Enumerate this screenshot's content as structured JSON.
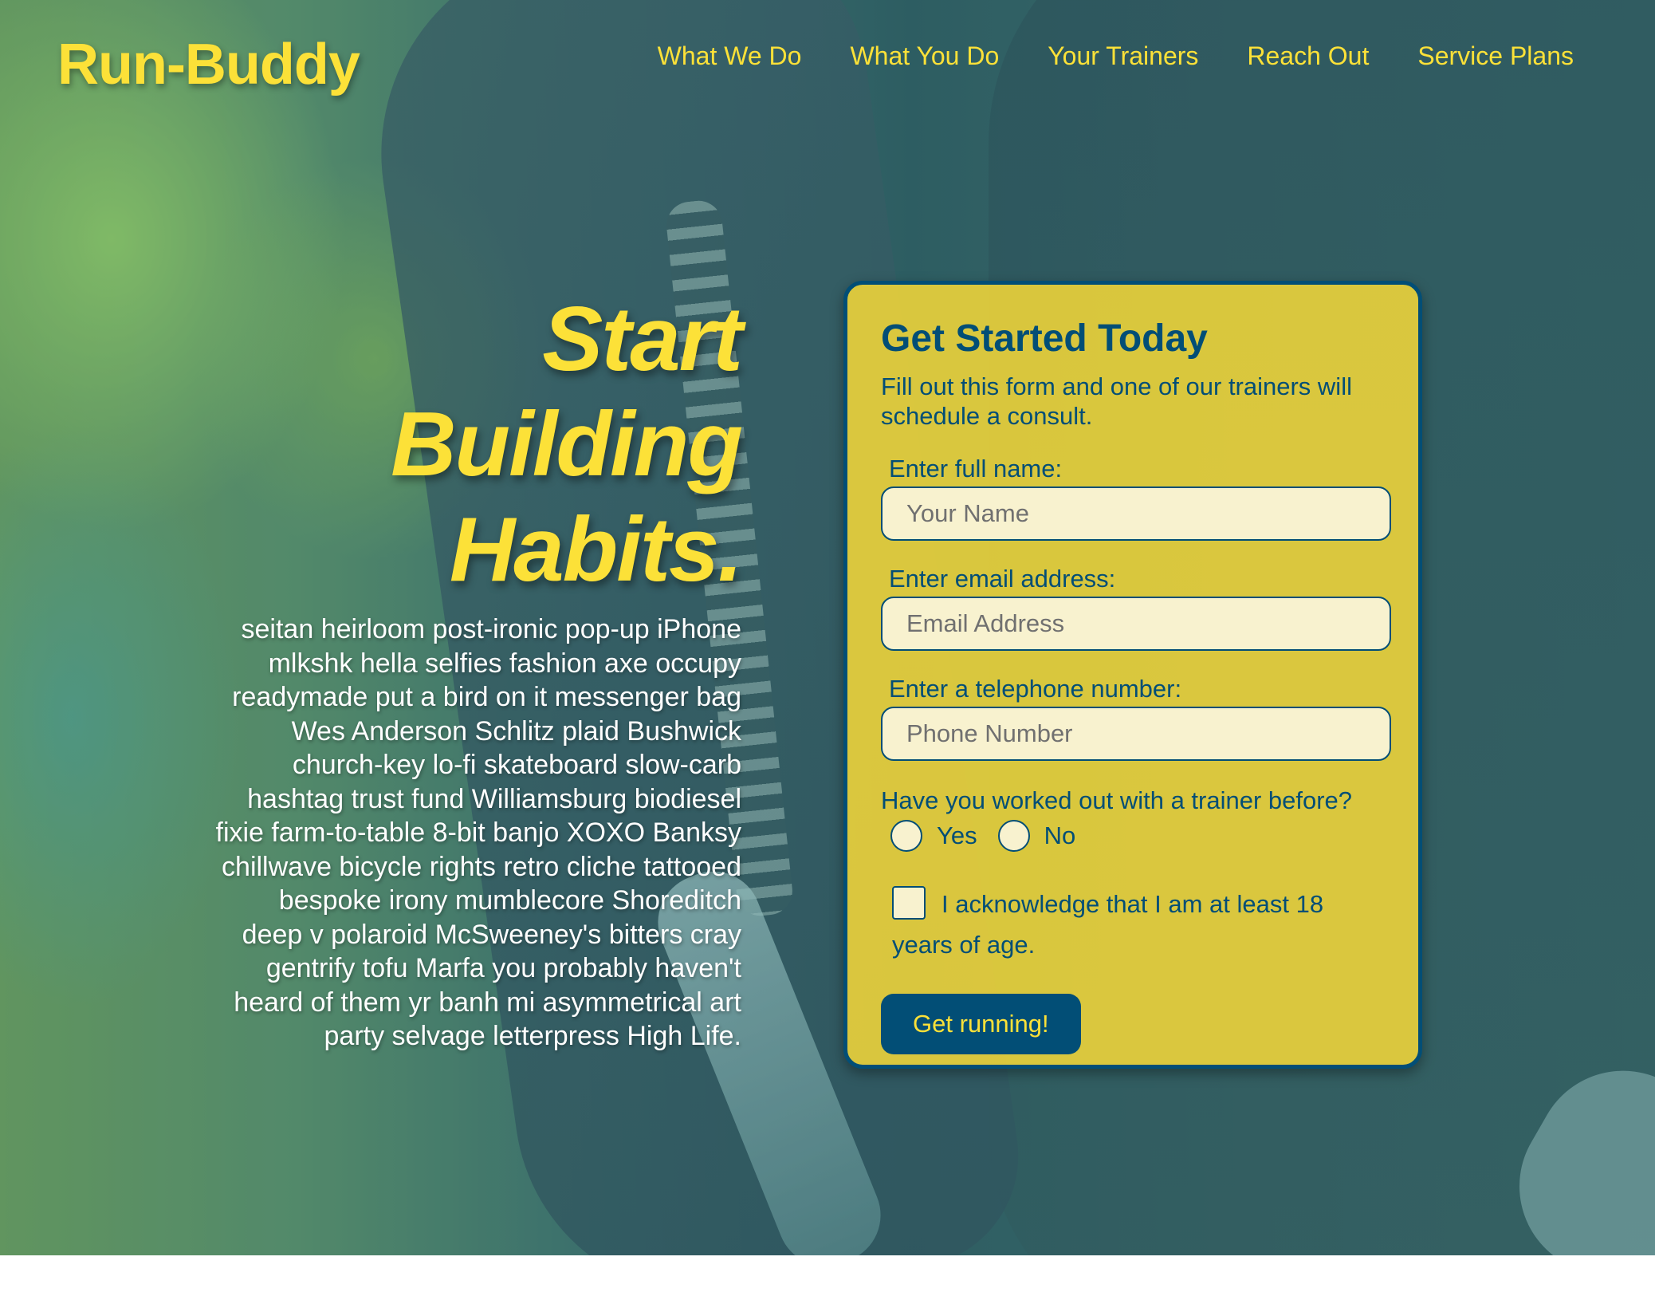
{
  "header": {
    "brand": "Run-Buddy",
    "nav": [
      {
        "label": "What We Do"
      },
      {
        "label": "What You Do"
      },
      {
        "label": "Your Trainers"
      },
      {
        "label": "Reach Out"
      },
      {
        "label": "Service Plans"
      }
    ]
  },
  "hero": {
    "headline_line1": "Start",
    "headline_line2": "Building",
    "headline_line3": "Habits.",
    "body": "seitan heirloom post-ironic pop-up iPhone mlkshk hella selfies fashion axe occupy readymade put a bird on it messenger bag Wes Anderson Schlitz plaid Bushwick church-key lo-fi skateboard slow-carb hashtag trust fund Williamsburg biodiesel fixie farm-to-table 8-bit banjo XOXO Banksy chillwave bicycle rights retro cliche tattooed bespoke irony mumblecore Shoreditch deep v polaroid McSweeney's bitters cray gentrify tofu Marfa you probably haven't heard of them yr banh mi asymmetrical art party selvage letterpress High Life."
  },
  "form": {
    "title": "Get Started Today",
    "subtitle": "Fill out this form and one of our trainers will schedule a consult.",
    "name_label": "Enter full name:",
    "name_placeholder": "Your Name",
    "name_value": "",
    "email_label": "Enter email address:",
    "email_placeholder": "Email Address",
    "email_value": "",
    "phone_label": "Enter a telephone number:",
    "phone_placeholder": "Phone Number",
    "phone_value": "",
    "trainer_question": "Have you worked out with a trainer before?",
    "option_yes": "Yes",
    "option_no": "No",
    "acknowledge": "I acknowledge that I am at least 18 years of age.",
    "submit_label": "Get running!"
  },
  "colors": {
    "brand_yellow": "#fce138",
    "brand_blue": "#024e76",
    "card_yellow": "#f6d838",
    "input_fill": "#f8f2cf"
  }
}
